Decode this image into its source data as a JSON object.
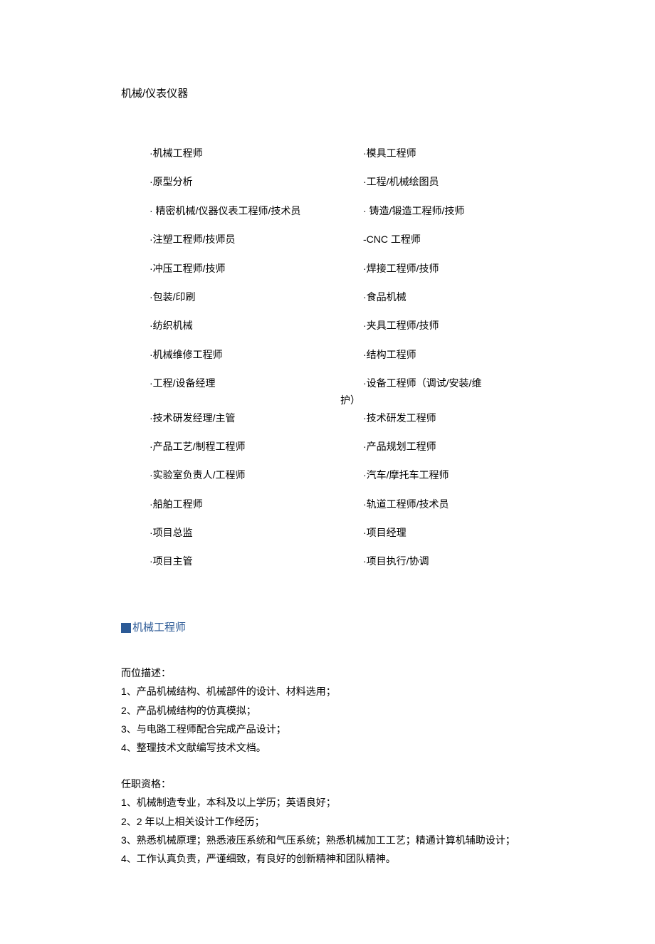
{
  "title": "机械/仪表仪器",
  "jobs": [
    {
      "left": "·机械工程师",
      "right": "·模具工程师"
    },
    {
      "left": "·原型分析",
      "right": "·工程/机械绘图员"
    },
    {
      "left": "· 精密机械/仪器仪表工程师/技术员",
      "right": "· 铸造/锻造工程师/技师"
    },
    {
      "left": "·注塑工程师/技师员",
      "right": "-CNC 工程师"
    },
    {
      "left": "·冲压工程师/技师",
      "right": "·焊接工程师/技师"
    },
    {
      "left": "·包装/印刷",
      "right": "·食品机械"
    },
    {
      "left": "·纺织机械",
      "right": "·夹具工程师/技师"
    },
    {
      "left": "·机械维修工程师",
      "right": "·结构工程师"
    },
    {
      "left": "·工程/设备经理",
      "right": "·设备工程师（调试/安装/维",
      "hanging": "护）"
    },
    {
      "left": "·技术研发经理/主管",
      "right": "·技术研发工程师"
    },
    {
      "left": "·产品工艺/制程工程师",
      "right": "·产品规划工程师"
    },
    {
      "left": "·实验室负责人/工程师",
      "right": "·汽车/摩托车工程师"
    },
    {
      "left": "·船舶工程师",
      "right": "·轨道工程师/技术员"
    },
    {
      "left": "·项目总监",
      "right": "·项目经理"
    },
    {
      "left": "·项目主管",
      "right": "·项目执行/协调"
    }
  ],
  "section": {
    "title": "机械工程师"
  },
  "description": {
    "label": "而位描述：",
    "items": [
      "1、产品机械结构、机械部件的设计、材料选用；",
      "2、产品机械结构的仿真模拟；",
      "3、与电路工程师配合完成产品设计；",
      "4、整理技术文献编写技术文档。"
    ]
  },
  "qualification": {
    "label": "任职资格：",
    "items": [
      "1、机械制造专业，本科及以上学历；英语良好；",
      "2、2 年以上相关设计工作经历；",
      "3、熟悉机械原理；熟悉液压系统和气压系统；熟悉机械加工工艺；精通计算机辅助设计；",
      "4、工作认真负责，严谨细致，有良好的创新精神和团队精神。"
    ]
  }
}
